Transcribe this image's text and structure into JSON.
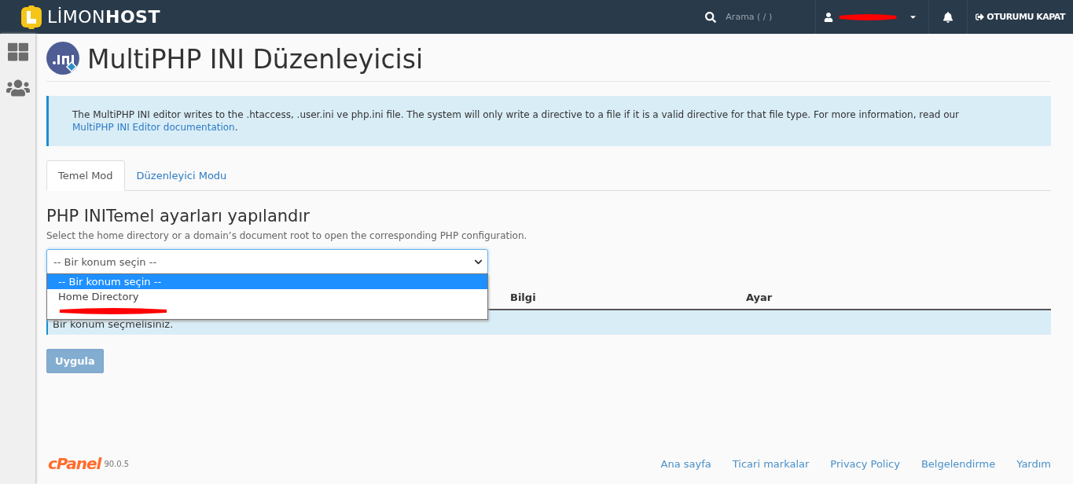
{
  "topbar": {
    "brand_light": "LİMON",
    "brand_bold": "HOST",
    "search_placeholder": "Arama ( / )",
    "user_redacted": true,
    "logout": "OTURUMU KAPAT"
  },
  "page": {
    "title": "MultiPHP INI Düzenleyicisi"
  },
  "notice": {
    "text": "The MultiPHP INI editor writes to the .htaccess, .user.ini ve php.ini file. The system will only write a directive to a file if it is a valid directive for that file type. For more information, read our ",
    "link": "MultiPHP INI Editor documentation",
    "end": "."
  },
  "tabs": [
    {
      "label": "Temel Mod",
      "selected": true
    },
    {
      "label": "Düzenleyici Modu",
      "selected": false
    }
  ],
  "section": {
    "heading": "PHP INITemel ayarları yapılandır",
    "description": "Select the home directory or a domain’s document root to open the corresponding PHP configuration."
  },
  "location_select": {
    "value": "-- Bir konum seçin --",
    "expanded": true,
    "options": [
      {
        "label": "-- Bir konum seçin --",
        "selected": true,
        "kind": "text"
      },
      {
        "label": "Home Directory",
        "selected": false,
        "kind": "text"
      },
      {
        "selected": false,
        "kind": "redacted"
      }
    ]
  },
  "table": {
    "columns": [
      "Bilgi",
      "Ayar"
    ],
    "message": "Bir konum seçmelisiniz."
  },
  "apply_button": {
    "label": "Uygula",
    "disabled": true
  },
  "footer": {
    "logo": "cPanel",
    "version": "90.0.5",
    "links": [
      "Ana sayfa",
      "Ticari markalar",
      "Privacy Policy",
      "Belgelendirme",
      "Yardım"
    ]
  }
}
